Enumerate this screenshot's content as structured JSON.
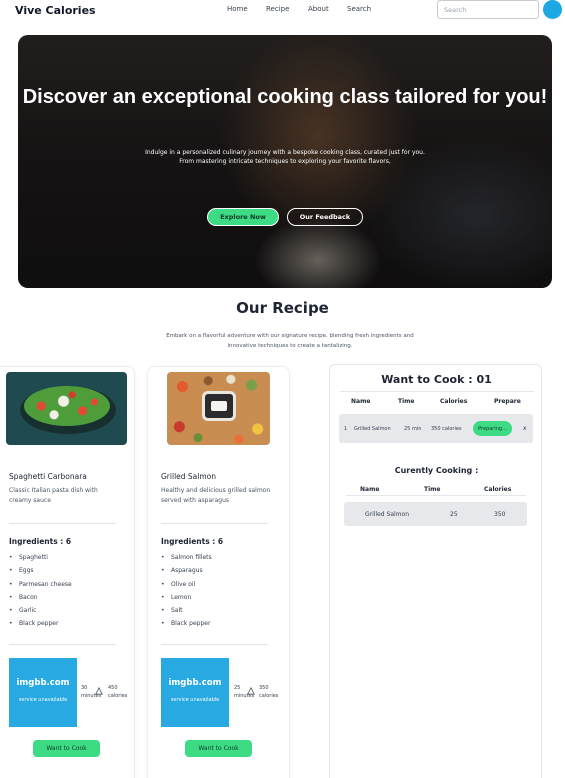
{
  "nav": {
    "brand": "Vive Calories",
    "links": [
      "Home",
      "Recipe",
      "About",
      "Search"
    ],
    "search_placeholder": "Search",
    "avatar_icon": "user-avatar-icon"
  },
  "hero": {
    "title": "Discover an exceptional cooking class tailored for you!",
    "subtitle_line1": "Indulge in a personalized culinary journey with a bespoke cooking class, curated just for you.",
    "subtitle_line2": "From mastering intricate techniques to exploring your favorite flavors,",
    "explore_label": "Explore Now",
    "feedback_label": "Our Feedback"
  },
  "section": {
    "title": "Our Recipe",
    "desc_line1": "Embark on a flavorful adventure with our signature recipe, blending fresh ingredients and",
    "desc_line2": "innovative techniques to create a tantalizing."
  },
  "recipes": [
    {
      "name": "Spaghetti Carbonara",
      "desc": "Classic Italian pasta dish with creamy sauce",
      "ingredients_label": "Ingredients : 6",
      "ingredients": [
        "Spaghetti",
        "Eggs",
        "Parmesan cheese",
        "Bacon",
        "Garlic",
        "Black pepper"
      ],
      "image_logo": "imgbb.com",
      "image_msg": "service unavailable",
      "time_value": "30",
      "time_unit": "minutes",
      "calories_value": "450",
      "calories_unit": "calories",
      "button_label": "Want to Cook"
    },
    {
      "name": "Grilled Salmon",
      "desc": "Healthy and delicious grilled salmon served with asparagus",
      "ingredients_label": "Ingredients : 6",
      "ingredients": [
        "Salmon fillets",
        "Asparagus",
        "Olive oil",
        "Lemon",
        "Salt",
        "Black pepper"
      ],
      "image_logo": "imgbb.com",
      "image_msg": "service unavailable",
      "time_value": "25",
      "time_unit": "minutes",
      "calories_value": "350",
      "calories_unit": "calories",
      "button_label": "Want to Cook"
    }
  ],
  "want": {
    "title": "Want to Cook : 01",
    "headers": [
      "Name",
      "Time",
      "Calories",
      "Prepare"
    ],
    "rows": [
      {
        "index": "1",
        "name": "Grilled Salmon",
        "time": "25 min",
        "calories": "350 calories",
        "action": "Preparing...",
        "close": "x"
      }
    ]
  },
  "cooking": {
    "title": "Curently Cooking :",
    "headers": [
      "Name",
      "Time",
      "Calories"
    ],
    "rows": [
      {
        "name": "Grilled Salmon",
        "time": "25",
        "calories": "350"
      }
    ]
  },
  "colors": {
    "accent_green": "#3ddc84",
    "imgbb_blue": "#29a9e1",
    "heading": "#1e2433"
  }
}
